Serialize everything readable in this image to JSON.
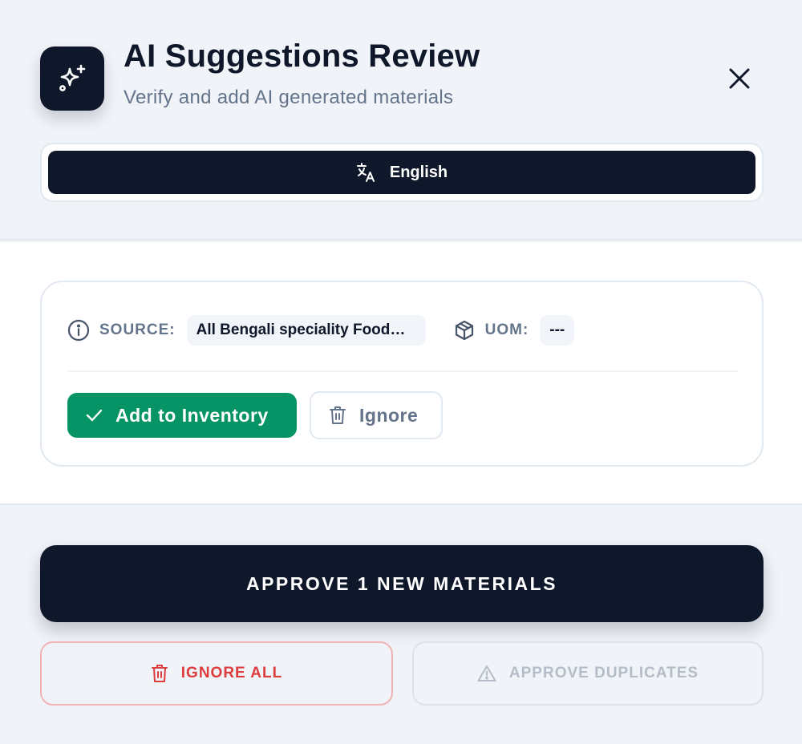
{
  "header": {
    "title": "AI Suggestions Review",
    "subtitle": "Verify and add AI generated materials",
    "app_icon": "sparkles-icon",
    "close_icon": "close-icon"
  },
  "language": {
    "label": "English",
    "icon": "translate-icon"
  },
  "suggestion": {
    "source_label": "SOURCE:",
    "source_value": "All Bengali speciality Food…",
    "uom_label": "UOM:",
    "uom_value": "---",
    "add_label": "Add to Inventory",
    "ignore_label": "Ignore",
    "icons": {
      "source": "info-icon",
      "uom": "box-icon",
      "add": "check-icon",
      "ignore": "trash-icon"
    }
  },
  "footer": {
    "approve_label": "APPROVE 1 NEW MATERIALS",
    "ignore_all_label": "IGNORE ALL",
    "approve_duplicates_label": "APPROVE DUPLICATES",
    "icons": {
      "ignore_all": "trash-icon",
      "approve_duplicates": "warning-icon"
    }
  },
  "colors": {
    "primary_dark": "#0f172a",
    "success": "#069466",
    "danger": "#dc3c3c",
    "muted": "#64748b",
    "disabled": "#b4bcc8"
  }
}
